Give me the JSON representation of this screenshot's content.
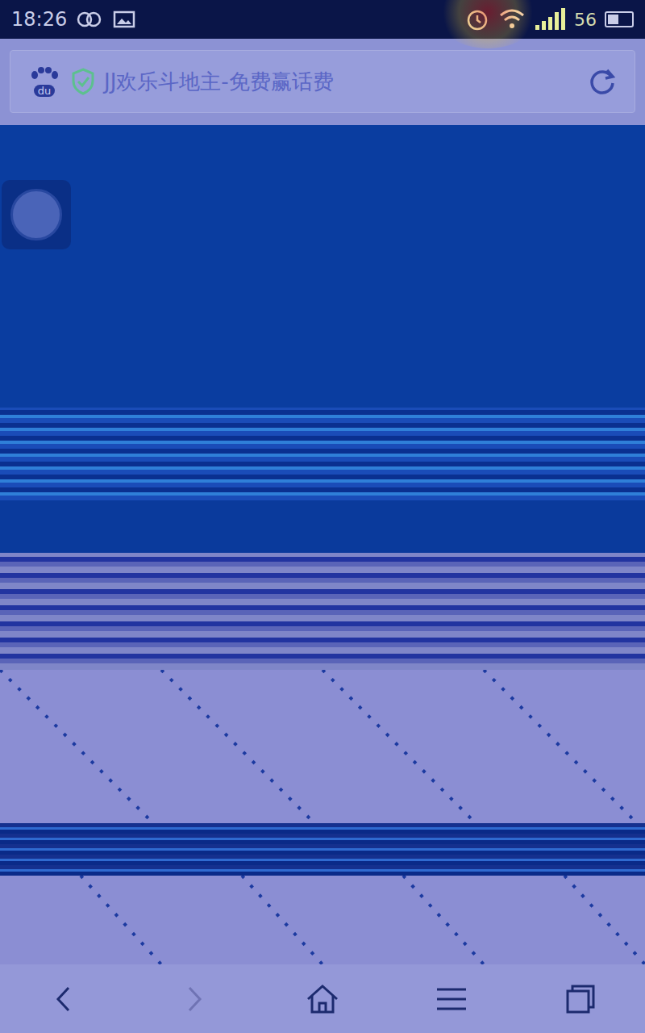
{
  "status_bar": {
    "time": "18:26",
    "network_label": "56",
    "battery_level": 0.45
  },
  "address_bar": {
    "logo_text": "du",
    "secure": true,
    "title": "JJ欢乐斗地主-免费赢话费"
  },
  "nav_buttons": [
    {
      "kind": "back",
      "disabled": false
    },
    {
      "kind": "forward",
      "disabled": true
    },
    {
      "kind": "home",
      "disabled": false
    },
    {
      "kind": "menu",
      "disabled": false
    },
    {
      "kind": "tabs",
      "disabled": false
    }
  ]
}
